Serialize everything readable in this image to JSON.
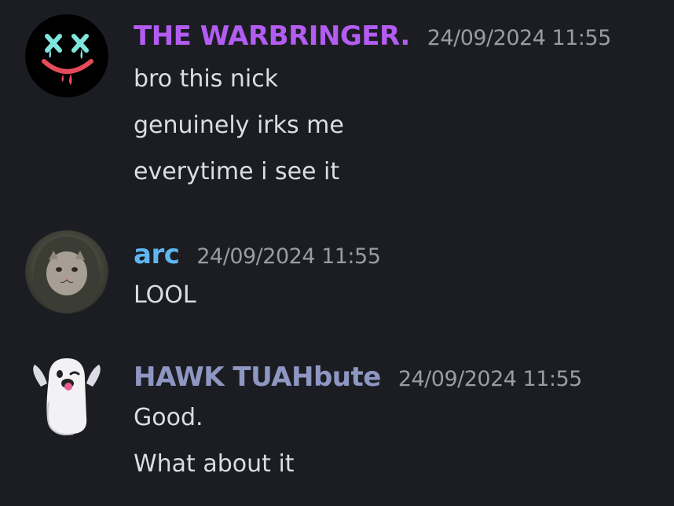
{
  "messages": [
    {
      "username": "THE WARBRINGER.",
      "username_color": "#b35cf2",
      "timestamp": "24/09/2024 11:55",
      "avatar": "marshmello-smiley-icon",
      "lines": [
        "bro this nick",
        "genuinely irks me",
        "everytime i see it"
      ]
    },
    {
      "username": "arc",
      "username_color": "#5fb6f0",
      "timestamp": "24/09/2024 11:55",
      "avatar": "hooded-cat-photo",
      "lines": [
        "LOOL"
      ]
    },
    {
      "username": "HAWK TUAHbute",
      "username_color": "#8e97c2",
      "timestamp": "24/09/2024 11:55",
      "avatar": "winking-ghost-icon",
      "lines": [
        "Good.",
        "What about it"
      ]
    }
  ]
}
